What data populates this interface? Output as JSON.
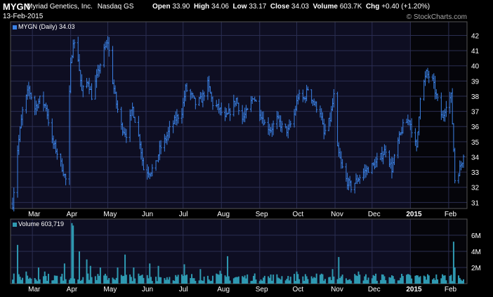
{
  "header": {
    "symbol": "MYGN",
    "name": "Myriad Genetics, Inc.",
    "exchange": "Nasdaq GS",
    "date": "13-Feb-2015",
    "open_label": "Open",
    "open": "33.90",
    "high_label": "High",
    "high": "34.06",
    "low_label": "Low",
    "low": "33.17",
    "close_label": "Close",
    "close": "34.03",
    "volume_label": "Volume",
    "volume": "603.7K",
    "chg_label": "Chg",
    "chg": "+0.40 (+1.20%)",
    "watermark": "© StockCharts.com"
  },
  "colors": {
    "background": "#000000",
    "panel": "#0e0e22",
    "highlight_panel": "#05050a",
    "grid": "#2b2e52",
    "price_bar": "#3b82e6",
    "volume_bar": "#2f9ab2",
    "text": "#ffffff"
  },
  "chart_data": [
    {
      "type": "ohlc",
      "legend": "MYGN (Daily) 34.03",
      "ylim": [
        30.6,
        42.9
      ],
      "y_ticks": [
        31,
        32,
        33,
        34,
        35,
        36,
        37,
        38,
        39,
        40,
        41,
        42
      ],
      "x_ticks": [
        {
          "label": "Mar",
          "date": "2014-03-01"
        },
        {
          "label": "Apr",
          "date": "2014-04-01"
        },
        {
          "label": "May",
          "date": "2014-05-01"
        },
        {
          "label": "Jun",
          "date": "2014-06-01"
        },
        {
          "label": "Jul",
          "date": "2014-07-01"
        },
        {
          "label": "Aug",
          "date": "2014-08-01"
        },
        {
          "label": "Sep",
          "date": "2014-09-01"
        },
        {
          "label": "Oct",
          "date": "2014-10-01"
        },
        {
          "label": "Nov",
          "date": "2014-11-01"
        },
        {
          "label": "Dec",
          "date": "2014-12-01"
        },
        {
          "label": "2015",
          "date": "2015-01-01",
          "bold": true
        },
        {
          "label": "Feb",
          "date": "2015-02-01"
        }
      ],
      "grid": true,
      "close_series": [
        {
          "date": "2014-02-13",
          "close": 30.9
        },
        {
          "date": "2014-02-17",
          "close": 34.5
        },
        {
          "date": "2014-02-21",
          "close": 37.0
        },
        {
          "date": "2014-02-26",
          "close": 38.5
        },
        {
          "date": "2014-03-03",
          "close": 37.2
        },
        {
          "date": "2014-03-07",
          "close": 37.8
        },
        {
          "date": "2014-03-12",
          "close": 37.3
        },
        {
          "date": "2014-03-17",
          "close": 35.0
        },
        {
          "date": "2014-03-20",
          "close": 34.5
        },
        {
          "date": "2014-03-25",
          "close": 33.3
        },
        {
          "date": "2014-03-28",
          "close": 32.5
        },
        {
          "date": "2014-04-01",
          "close": 40.0
        },
        {
          "date": "2014-04-03",
          "close": 41.7
        },
        {
          "date": "2014-04-07",
          "close": 40.5
        },
        {
          "date": "2014-04-10",
          "close": 38.3
        },
        {
          "date": "2014-04-15",
          "close": 39.0
        },
        {
          "date": "2014-04-18",
          "close": 38.0
        },
        {
          "date": "2014-04-23",
          "close": 39.5
        },
        {
          "date": "2014-04-28",
          "close": 41.0
        },
        {
          "date": "2014-05-01",
          "close": 41.6
        },
        {
          "date": "2014-05-05",
          "close": 39.0
        },
        {
          "date": "2014-05-08",
          "close": 37.5
        },
        {
          "date": "2014-05-12",
          "close": 36.0
        },
        {
          "date": "2014-05-16",
          "close": 35.5
        },
        {
          "date": "2014-05-21",
          "close": 37.2
        },
        {
          "date": "2014-05-27",
          "close": 35.0
        },
        {
          "date": "2014-05-30",
          "close": 33.2
        },
        {
          "date": "2014-06-04",
          "close": 33.0
        },
        {
          "date": "2014-06-09",
          "close": 33.5
        },
        {
          "date": "2014-06-12",
          "close": 34.5
        },
        {
          "date": "2014-06-17",
          "close": 35.2
        },
        {
          "date": "2014-06-20",
          "close": 35.8
        },
        {
          "date": "2014-06-25",
          "close": 36.5
        },
        {
          "date": "2014-06-30",
          "close": 37.0
        },
        {
          "date": "2014-07-03",
          "close": 38.5
        },
        {
          "date": "2014-07-08",
          "close": 38.0
        },
        {
          "date": "2014-07-11",
          "close": 37.5
        },
        {
          "date": "2014-07-16",
          "close": 37.8
        },
        {
          "date": "2014-07-21",
          "close": 38.8
        },
        {
          "date": "2014-07-25",
          "close": 37.5
        },
        {
          "date": "2014-07-30",
          "close": 37.2
        },
        {
          "date": "2014-08-04",
          "close": 36.5
        },
        {
          "date": "2014-08-08",
          "close": 37.0
        },
        {
          "date": "2014-08-13",
          "close": 37.8
        },
        {
          "date": "2014-08-18",
          "close": 36.5
        },
        {
          "date": "2014-08-22",
          "close": 37.0
        },
        {
          "date": "2014-08-27",
          "close": 38.0
        },
        {
          "date": "2014-09-02",
          "close": 36.8
        },
        {
          "date": "2014-09-05",
          "close": 36.2
        },
        {
          "date": "2014-09-10",
          "close": 35.8
        },
        {
          "date": "2014-09-15",
          "close": 36.5
        },
        {
          "date": "2014-09-19",
          "close": 36.0
        },
        {
          "date": "2014-09-24",
          "close": 35.7
        },
        {
          "date": "2014-09-29",
          "close": 36.8
        },
        {
          "date": "2014-10-02",
          "close": 38.0
        },
        {
          "date": "2014-10-07",
          "close": 37.8
        },
        {
          "date": "2014-10-10",
          "close": 38.5
        },
        {
          "date": "2014-10-15",
          "close": 37.5
        },
        {
          "date": "2014-10-20",
          "close": 37.0
        },
        {
          "date": "2014-10-23",
          "close": 35.5
        },
        {
          "date": "2014-10-28",
          "close": 36.5
        },
        {
          "date": "2014-10-31",
          "close": 38.0
        },
        {
          "date": "2014-11-03",
          "close": 34.5
        },
        {
          "date": "2014-11-06",
          "close": 33.5
        },
        {
          "date": "2014-11-10",
          "close": 32.5
        },
        {
          "date": "2014-11-14",
          "close": 32.0
        },
        {
          "date": "2014-11-19",
          "close": 32.5
        },
        {
          "date": "2014-11-24",
          "close": 33.0
        },
        {
          "date": "2014-11-28",
          "close": 33.2
        },
        {
          "date": "2014-12-03",
          "close": 33.5
        },
        {
          "date": "2014-12-08",
          "close": 34.0
        },
        {
          "date": "2014-12-12",
          "close": 34.5
        },
        {
          "date": "2014-12-17",
          "close": 33.2
        },
        {
          "date": "2014-12-22",
          "close": 35.0
        },
        {
          "date": "2014-12-26",
          "close": 36.0
        },
        {
          "date": "2014-12-31",
          "close": 36.5
        },
        {
          "date": "2015-01-06",
          "close": 34.5
        },
        {
          "date": "2015-01-09",
          "close": 38.0
        },
        {
          "date": "2015-01-14",
          "close": 39.5
        },
        {
          "date": "2015-01-19",
          "close": 39.0
        },
        {
          "date": "2015-01-22",
          "close": 38.0
        },
        {
          "date": "2015-01-27",
          "close": 36.5
        },
        {
          "date": "2015-01-30",
          "close": 37.5
        },
        {
          "date": "2015-02-03",
          "close": 38.0
        },
        {
          "date": "2015-02-05",
          "close": 34.5
        },
        {
          "date": "2015-02-06",
          "close": 32.5
        },
        {
          "date": "2015-02-09",
          "close": 33.0
        },
        {
          "date": "2015-02-11",
          "close": 33.5
        },
        {
          "date": "2015-02-13",
          "close": 34.03
        }
      ]
    },
    {
      "type": "bar",
      "legend": "Volume 603,719",
      "ylim": [
        0,
        8000000
      ],
      "y_ticks": [
        {
          "value": 2000000,
          "label": "2M"
        },
        {
          "value": 4000000,
          "label": "4M"
        },
        {
          "value": 6000000,
          "label": "6M"
        }
      ],
      "series": [
        {
          "baseline_volume": 800000,
          "spikes": [
            {
              "date": "2014-02-17",
              "value": 4800000
            },
            {
              "date": "2014-02-24",
              "value": 1500000
            },
            {
              "date": "2014-03-06",
              "value": 2000000
            },
            {
              "date": "2014-03-11",
              "value": 1500000
            },
            {
              "date": "2014-03-27",
              "value": 2500000
            },
            {
              "date": "2014-04-02",
              "value": 7500000
            },
            {
              "date": "2014-04-03",
              "value": 7200000
            },
            {
              "date": "2014-04-08",
              "value": 4000000
            },
            {
              "date": "2014-04-14",
              "value": 3000000
            },
            {
              "date": "2014-04-17",
              "value": 2200000
            },
            {
              "date": "2014-04-25",
              "value": 2000000
            },
            {
              "date": "2014-05-09",
              "value": 2000000
            },
            {
              "date": "2014-05-15",
              "value": 3600000
            },
            {
              "date": "2014-05-22",
              "value": 2000000
            },
            {
              "date": "2014-06-04",
              "value": 2500000
            },
            {
              "date": "2014-06-11",
              "value": 2200000
            },
            {
              "date": "2014-07-02",
              "value": 2400000
            },
            {
              "date": "2014-07-15",
              "value": 1800000
            },
            {
              "date": "2014-07-31",
              "value": 1600000
            },
            {
              "date": "2014-08-06",
              "value": 3400000
            },
            {
              "date": "2014-10-01",
              "value": 1500000
            },
            {
              "date": "2014-10-30",
              "value": 1800000
            },
            {
              "date": "2014-11-04",
              "value": 3300000
            },
            {
              "date": "2014-11-20",
              "value": 1500000
            },
            {
              "date": "2015-02-05",
              "value": 5200000
            },
            {
              "date": "2015-02-06",
              "value": 2000000
            }
          ]
        }
      ]
    }
  ]
}
